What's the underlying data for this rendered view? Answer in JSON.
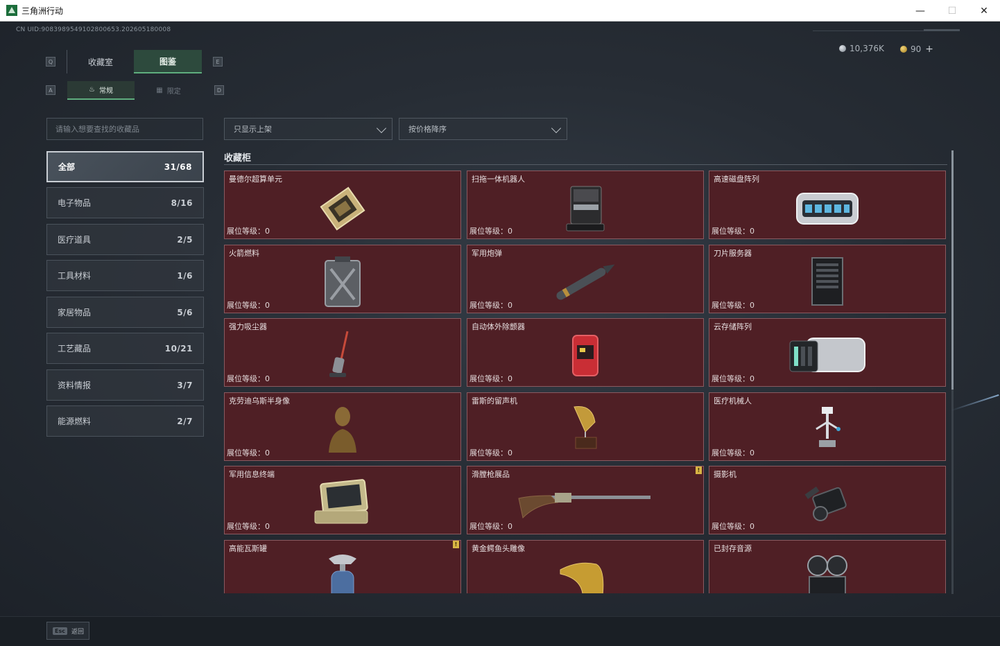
{
  "window": {
    "title": "三角洲行动",
    "minimize": "—",
    "maximize": "☐",
    "close": "✕"
  },
  "uid": "CN UID:9083989549102800653.202605180008",
  "currency": {
    "silver": "10,376K",
    "gold": "90",
    "add": "+"
  },
  "keys": {
    "tab_left": "Q",
    "tab_right": "E",
    "sub_left": "A",
    "sub_right": "D"
  },
  "tabs": [
    {
      "label": "收藏室"
    },
    {
      "label": "图鉴"
    }
  ],
  "subtabs": [
    {
      "label": "常规",
      "icon": "♨"
    },
    {
      "label": "限定",
      "icon": "▦"
    }
  ],
  "search": {
    "placeholder": "请输入想要查找的收藏品"
  },
  "filters": {
    "shelf": "只显示上架",
    "sort": "按价格降序"
  },
  "categories": [
    {
      "label": "全部",
      "count": "31/68"
    },
    {
      "label": "电子物品",
      "count": "8/16"
    },
    {
      "label": "医疗道具",
      "count": "2/5"
    },
    {
      "label": "工具材料",
      "count": "1/6"
    },
    {
      "label": "家居物品",
      "count": "5/6"
    },
    {
      "label": "工艺藏品",
      "count": "10/21"
    },
    {
      "label": "资料情报",
      "count": "3/7"
    },
    {
      "label": "能源燃料",
      "count": "2/7"
    }
  ],
  "cabinet": {
    "title": "收藏柜",
    "items": [
      {
        "name": "曼德尔超算单元",
        "level": "展位等级：0",
        "badge": "",
        "icon": "chip"
      },
      {
        "name": "扫拖一体机器人",
        "level": "展位等级：0",
        "badge": "",
        "icon": "robot-vacuum"
      },
      {
        "name": "高速磁盘阵列",
        "level": "展位等级：0",
        "badge": "",
        "icon": "disk-array"
      },
      {
        "name": "火箭燃料",
        "level": "展位等级：0",
        "badge": "",
        "icon": "jerrycan"
      },
      {
        "name": "军用炮弹",
        "level": "展位等级：0",
        "badge": "",
        "icon": "shell"
      },
      {
        "name": "刀片服务器",
        "level": "展位等级：0",
        "badge": "",
        "icon": "server"
      },
      {
        "name": "强力吸尘器",
        "level": "展位等级：0",
        "badge": "",
        "icon": "vacuum"
      },
      {
        "name": "自动体外除颤器",
        "level": "展位等级：0",
        "badge": "",
        "icon": "defibrillator"
      },
      {
        "name": "云存储阵列",
        "level": "展位等级：0",
        "badge": "",
        "icon": "storage"
      },
      {
        "name": "克劳迪乌斯半身像",
        "level": "展位等级：0",
        "badge": "",
        "icon": "bust"
      },
      {
        "name": "雷斯的留声机",
        "level": "展位等级：0",
        "badge": "",
        "icon": "gramophone"
      },
      {
        "name": "医疗机械人",
        "level": "展位等级：0",
        "badge": "",
        "icon": "med-robot"
      },
      {
        "name": "军用信息终端",
        "level": "展位等级：0",
        "badge": "",
        "icon": "terminal"
      },
      {
        "name": "滑膛枪展品",
        "level": "展位等级：0",
        "badge": "!",
        "icon": "musket"
      },
      {
        "name": "摄影机",
        "level": "展位等级：0",
        "badge": "",
        "icon": "camera"
      },
      {
        "name": "高能瓦斯罐",
        "level": "",
        "badge": "!",
        "icon": "gas-tank"
      },
      {
        "name": "黄金鳄鱼头雕像",
        "level": "",
        "badge": "",
        "icon": "croc-statue"
      },
      {
        "name": "已封存音源",
        "level": "",
        "badge": "",
        "icon": "film-reel"
      }
    ]
  },
  "footer": {
    "esc_key": "Esc",
    "esc_label": "返回"
  }
}
